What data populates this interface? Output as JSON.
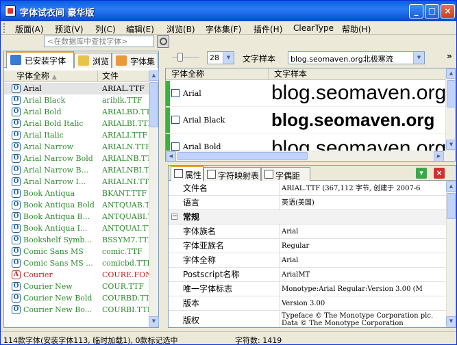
{
  "window": {
    "title": "字体试衣间  豪华版"
  },
  "titlebar_buttons": [
    "_",
    "□",
    "×"
  ],
  "menu": [
    "版面(A)",
    "预览(V)",
    "列(C)",
    "编辑(E)",
    "浏览(B)",
    "字体集(F)",
    "插件(H)",
    "ClearType",
    "帮助(H)"
  ],
  "search": {
    "placeholder": "<在数据库中查找字体>"
  },
  "left_tabs": [
    "已安装字体",
    "浏览",
    "字体集"
  ],
  "font_list": {
    "headers": [
      "字体全称",
      "文件"
    ],
    "rows": [
      {
        "name": "Arial",
        "file": "ARIAL.TTF"
      },
      {
        "name": "Arial Black",
        "file": "ariblk.TTF"
      },
      {
        "name": "Arial Bold",
        "file": "ARIALBD.TTF"
      },
      {
        "name": "Arial Bold Italic",
        "file": "ARIALBI.TTF"
      },
      {
        "name": "Arial Italic",
        "file": "ARIALI.TTF"
      },
      {
        "name": "Arial Narrow",
        "file": "ARIALN.TTF"
      },
      {
        "name": "Arial Narrow Bold",
        "file": "ARIALNB.TTF"
      },
      {
        "name": "Arial Narrow B...",
        "file": "ARIALNBI.TTF"
      },
      {
        "name": "Arial Narrow I...",
        "file": "ARIALNI.TTF"
      },
      {
        "name": "Book Antiqua",
        "file": "BKANT.TTF"
      },
      {
        "name": "Book Antiqua Bold",
        "file": "ANTQUAB.TTF"
      },
      {
        "name": "Book Antiqua B...",
        "file": "ANTQUABI.TTF"
      },
      {
        "name": "Book Antiqua I...",
        "file": "ANTQUAI.TTF"
      },
      {
        "name": "Bookshelf Symb...",
        "file": "BSSYM7.TTF"
      },
      {
        "name": "Comic Sans MS",
        "file": "comic.TTF"
      },
      {
        "name": "Comic Sans MS ...",
        "file": "comicbd.TTF"
      },
      {
        "name": "Courier",
        "file": "COURE.FON"
      },
      {
        "name": "Courier New",
        "file": "COUR.TTF"
      },
      {
        "name": "Courier New Bold",
        "file": "COURBD.TTF"
      },
      {
        "name": "Courier New Bo...",
        "file": "COURBI.TTF"
      }
    ]
  },
  "toolbar": {
    "size": "28",
    "sample_label": "文字样本",
    "sample_text": "blog.seomaven.org北极寒流"
  },
  "samples": {
    "headers": [
      "字体全称",
      "文字样本"
    ],
    "rows": [
      {
        "name": "Arial",
        "sample": "blog.seomaven.org"
      },
      {
        "name": "Arial Black",
        "sample": "blog.seomaven.org"
      },
      {
        "name": "Arial Bold",
        "sample": "blog.seomaven.org"
      }
    ]
  },
  "prop_tabs": [
    "属性",
    "字符映射表",
    "字偶距"
  ],
  "properties": [
    {
      "key": "文件名",
      "value": "ARIAL.TTF (367,112 字节, 创建于 2007-6"
    },
    {
      "key": "语言",
      "value": "英语(美国)"
    },
    {
      "key": "常规",
      "category": true
    },
    {
      "key": "字体族名",
      "value": "Arial"
    },
    {
      "key": "字体亚族名",
      "value": "Regular"
    },
    {
      "key": "字体全称",
      "value": "Arial"
    },
    {
      "key": "Postscript名称",
      "value": "ArialMT"
    },
    {
      "key": "唯一字体标志",
      "value": "Monotype:Arial Regular:Version 3.00 (M"
    },
    {
      "key": "版本",
      "value": "Version 3.00"
    },
    {
      "key": "版权",
      "value": "Typeface © The Monotype Corporation plc. Data © The Monotype Corporation"
    }
  ],
  "status": {
    "left": "114款字体(安装字体113, 临时加载1), 0款标记选中",
    "right": "字符数: 1419"
  }
}
